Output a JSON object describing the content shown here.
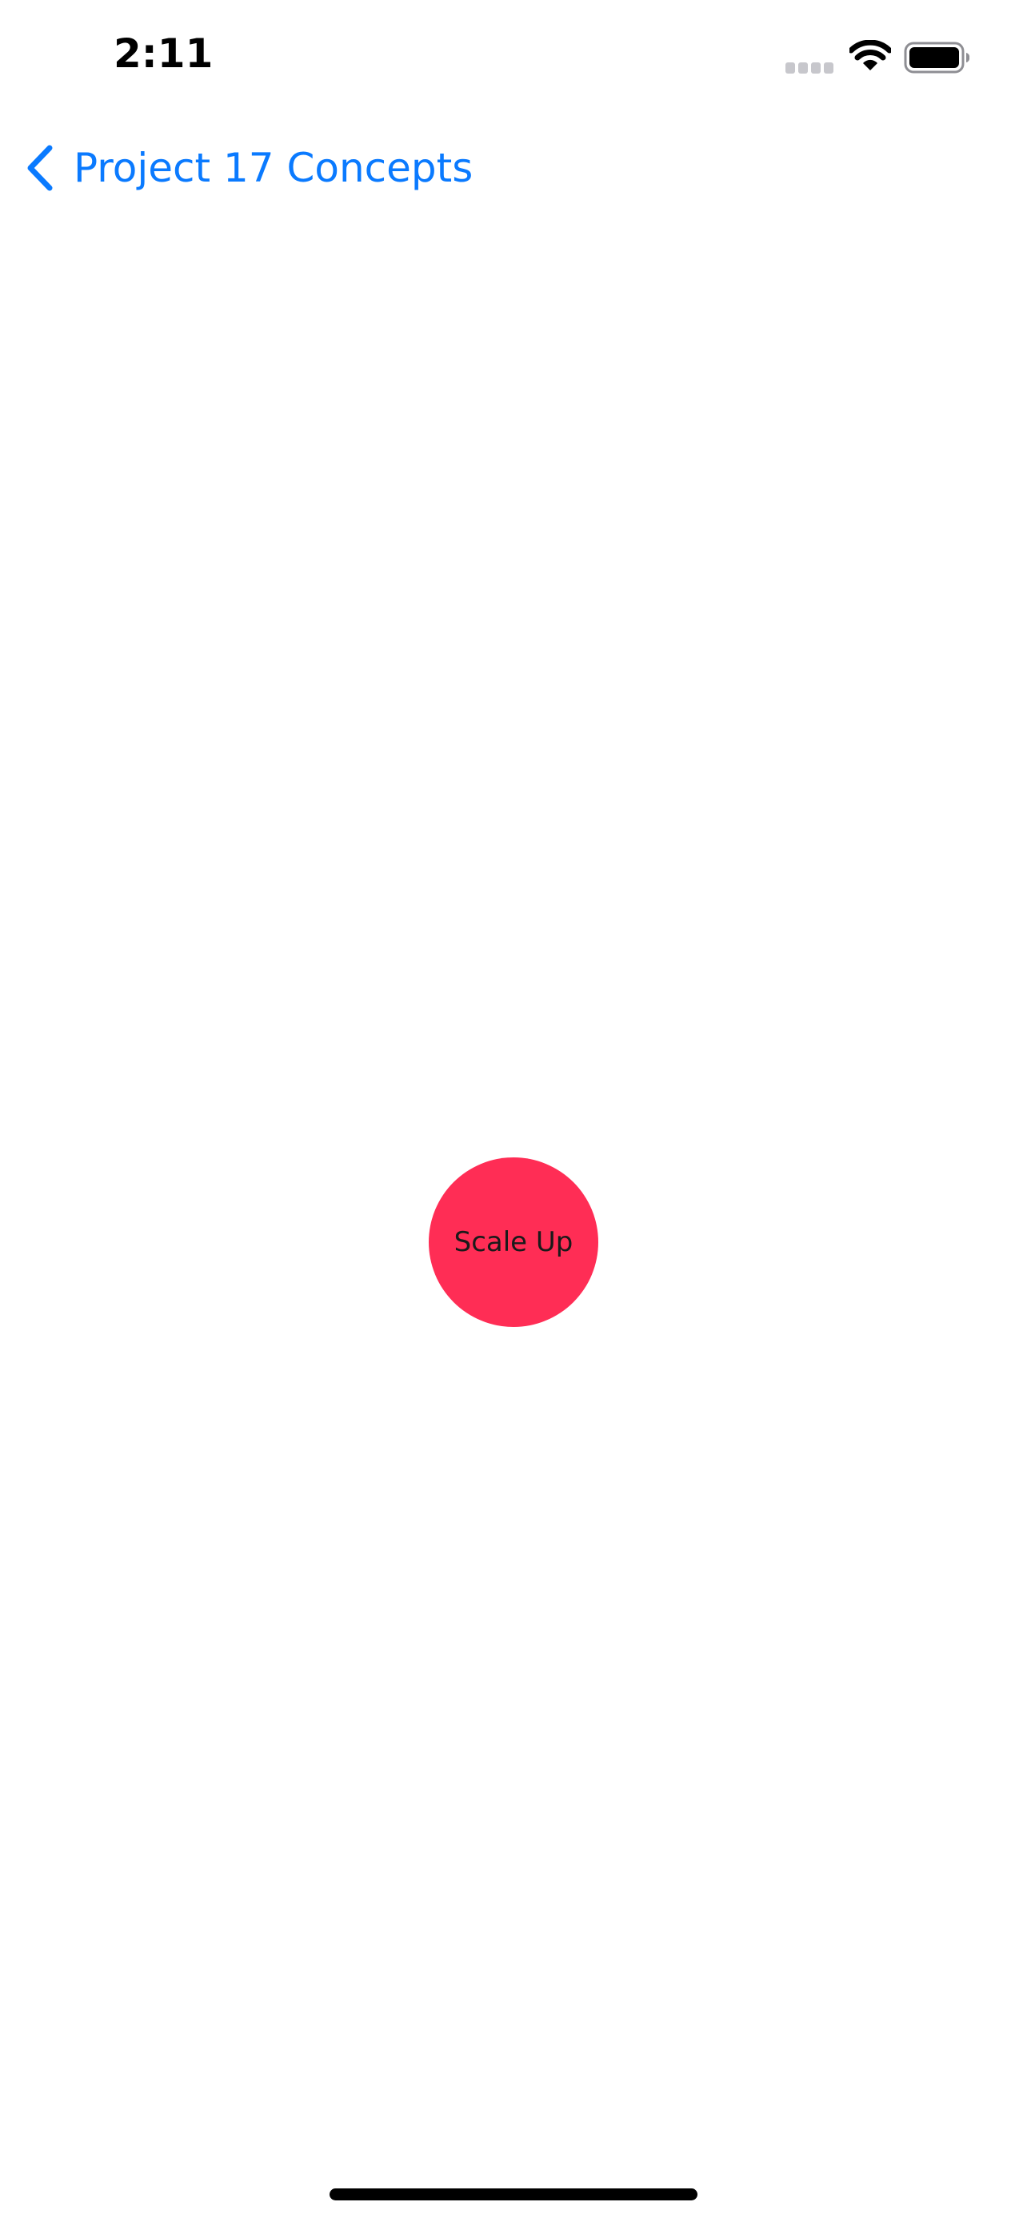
{
  "status_bar": {
    "time": "2:11",
    "icons": [
      "cellular-signal-icon",
      "wifi-icon",
      "battery-icon"
    ]
  },
  "nav": {
    "back_label": "Project 17 Concepts",
    "back_icon": "chevron-left-icon",
    "accent_color": "#0a7aff"
  },
  "main": {
    "button_label": "Scale Up",
    "button_color": "#ff2d55"
  }
}
